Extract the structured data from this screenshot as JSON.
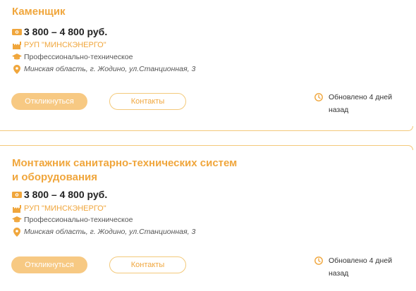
{
  "colors": {
    "accent": "#f0a63c",
    "button_fill": "#f7c983",
    "border": "#f3c97a"
  },
  "vacancies": [
    {
      "title": "Каменщик",
      "salary": "3 800 – 4 800 руб.",
      "company": "РУП \"МИНСКЭНЕРГО\"",
      "education": "Профессионально-техническое",
      "address": "Минская область, г. Жодино, ул.Станционная, 3",
      "respond_label": "Откликнуться",
      "contacts_label": "Контакты",
      "updated": "Обновлено 4 дней назад",
      "icons": {
        "salary": "money-icon",
        "company": "factory-icon",
        "education": "graduation-cap-icon",
        "address": "map-pin-icon",
        "updated": "clock-icon"
      }
    },
    {
      "title": "Монтажник санитарно-технических систем и оборудования",
      "salary": "3 800 – 4 800 руб.",
      "company": "РУП \"МИНСКЭНЕРГО\"",
      "education": "Профессионально-техническое",
      "address": "Минская область, г. Жодино, ул.Станционная, 3",
      "respond_label": "Откликнуться",
      "contacts_label": "Контакты",
      "updated": "Обновлено 4 дней назад",
      "icons": {
        "salary": "money-icon",
        "company": "factory-icon",
        "education": "graduation-cap-icon",
        "address": "map-pin-icon",
        "updated": "clock-icon"
      }
    }
  ]
}
